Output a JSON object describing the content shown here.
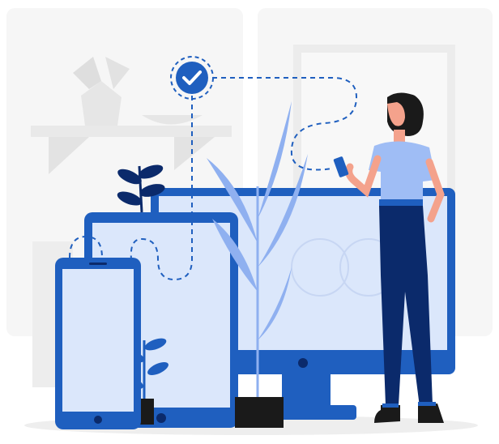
{
  "illustration": {
    "colors": {
      "primary": "#1f5fbf",
      "primary_dark": "#0b2a6b",
      "accent_light": "#8fb0f0",
      "screen": "#dbe7fb",
      "background_shapes": "#f0f0f0",
      "plant_pot": "#1a1a1a",
      "skin": "#f4a28c",
      "hair": "#1a1a1a",
      "shirt": "#9fbdf5",
      "pants": "#0b2a6b"
    },
    "icons": {
      "verification_badge": "check-badge-icon"
    }
  }
}
